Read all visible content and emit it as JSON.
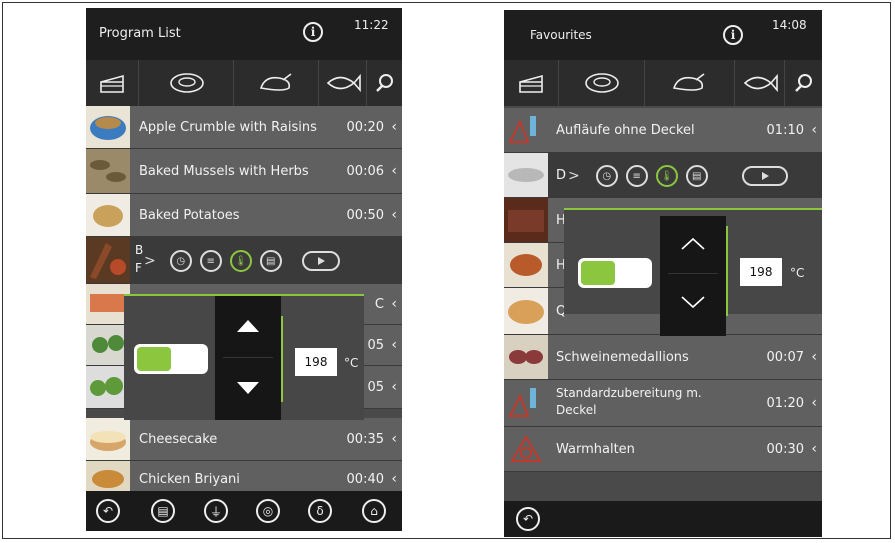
{
  "left": {
    "header": {
      "title": "Program List",
      "info_symbol": "i",
      "time": "11:22"
    },
    "categories": [
      "cake-icon",
      "meat-icon",
      "poultry-icon",
      "fish-icon",
      "search-icon"
    ],
    "rows": [
      {
        "name": "Apple Crumble with Raisins",
        "duration": "00:20",
        "chevron": "‹",
        "thumb_color": "#3b7bbf"
      },
      {
        "name": "Baked Mussels with Herbs",
        "duration": "00:06",
        "chevron": "‹",
        "thumb_color": "#6b5a3a"
      },
      {
        "name": "Baked Potatoes",
        "duration": "00:50",
        "chevron": "‹",
        "thumb_color": "#c9a15a"
      },
      {
        "name_line1": "B",
        "name_line2": "F",
        "thumb_color": "#8a4a2a"
      },
      {
        "duration_partial": "C",
        "chevron": "‹",
        "thumb_color": "#d9784a"
      },
      {
        "duration_partial": "05",
        "chevron": "‹",
        "thumb_color": "#4f8a3a"
      },
      {
        "duration_partial": "05",
        "chevron": "‹",
        "thumb_color": "#5f9a3a"
      },
      {
        "name": "Cheesecake",
        "duration": "00:35",
        "chevron": "‹",
        "thumb_color": "#d7a46a"
      },
      {
        "name": "Chicken Briyani",
        "duration": "00:40",
        "chevron": "‹",
        "thumb_color": "#c98a3a"
      }
    ],
    "control_nav": ">",
    "panel": {
      "value": "198",
      "unit": "°C",
      "toggle_on": true
    },
    "bottom_icons": [
      "back-icon",
      "steam-icon",
      "core-temp-icon",
      "plate-icon",
      "delta-t-icon",
      "cloche-icon"
    ]
  },
  "right": {
    "header": {
      "title": "Favourites",
      "info_symbol": "i",
      "time": "14:08"
    },
    "categories": [
      "cake-icon",
      "meat-icon",
      "poultry-icon",
      "fish-icon",
      "search-icon"
    ],
    "rows": [
      {
        "name": "Aufläufe ohne Deckel",
        "duration": "01:10",
        "chevron": "‹",
        "thumb_color": "#c0392b",
        "icon": true
      },
      {
        "name": "D",
        "thumb_color": "#b8b8b8"
      },
      {
        "name": "H",
        "thumb_color": "#7a3a2a"
      },
      {
        "name": "H",
        "thumb_color": "#b85a2a"
      },
      {
        "name": "Q",
        "thumb_color": "#d9a05a"
      },
      {
        "name": "Schweinemedallions",
        "duration": "00:07",
        "chevron": "‹",
        "thumb_color": "#8a3a3a"
      },
      {
        "name_line1": "Standardzubereitung m.",
        "name_line2": "Deckel",
        "duration": "01:20",
        "chevron": "‹",
        "thumb_color": "#c0392b",
        "icon": true
      },
      {
        "name": "Warmhalten",
        "duration": "00:30",
        "chevron": "‹",
        "thumb_color": "#c0392b",
        "icon": true
      }
    ],
    "control_nav": ">",
    "panel": {
      "value": "198",
      "unit": "°C",
      "toggle_on": true
    },
    "bottom_icons": [
      "back-icon"
    ]
  },
  "colors": {
    "accent": "#8cc63f",
    "header": "#1e1e1e",
    "row": "#606060"
  }
}
